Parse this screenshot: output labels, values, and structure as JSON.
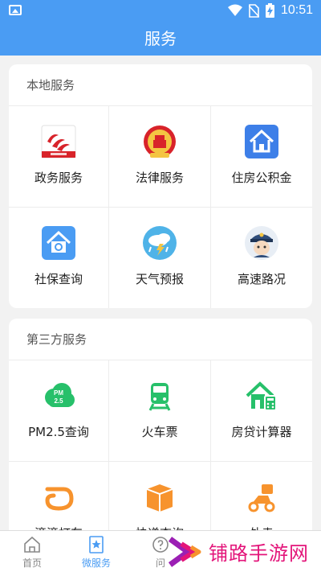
{
  "status_bar": {
    "time": "10:51",
    "icons": [
      "gallery-icon",
      "wifi-icon",
      "no-sim-icon",
      "battery-charging-icon"
    ]
  },
  "header": {
    "title": "服务"
  },
  "local_services": {
    "title": "本地服务",
    "items": [
      {
        "label": "政务服务",
        "icon": "government-affairs-icon"
      },
      {
        "label": "法律服务",
        "icon": "law-emblem-icon"
      },
      {
        "label": "住房公积金",
        "icon": "housing-fund-icon"
      },
      {
        "label": "社保查询",
        "icon": "social-security-icon"
      },
      {
        "label": "天气预报",
        "icon": "weather-icon"
      },
      {
        "label": "高速路况",
        "icon": "traffic-police-icon"
      }
    ]
  },
  "third_party_services": {
    "title": "第三方服务",
    "items": [
      {
        "label": "PM2.5查询",
        "icon": "pm25-cloud-icon"
      },
      {
        "label": "火车票",
        "icon": "train-icon"
      },
      {
        "label": "房贷计算器",
        "icon": "mortgage-calculator-icon"
      },
      {
        "label": "滴滴打车",
        "icon": "didi-icon"
      },
      {
        "label": "快递查询",
        "icon": "package-icon"
      },
      {
        "label": "外卖",
        "icon": "delivery-scooter-icon"
      }
    ]
  },
  "tab_bar": {
    "tabs": [
      {
        "label": "首页",
        "icon": "home-icon",
        "active": false
      },
      {
        "label": "微服务",
        "icon": "star-bookmark-icon",
        "active": true
      },
      {
        "label": "问",
        "icon": "question-icon",
        "active": false
      }
    ]
  },
  "watermark": {
    "text": "铺路手游网"
  },
  "colors": {
    "primary": "#4a9cf3",
    "green": "#27c06a",
    "orange": "#f7932d",
    "watermark": "#e3157a"
  }
}
